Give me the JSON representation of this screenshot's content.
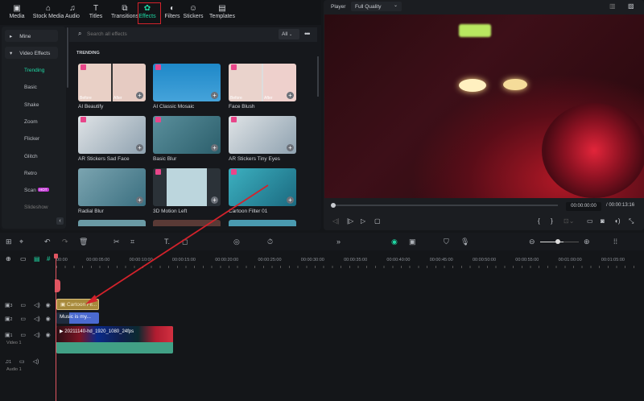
{
  "toolbar": {
    "tabs": [
      {
        "label": "Media",
        "icon": "media-icon"
      },
      {
        "label": "Stock Media",
        "icon": "stock-icon"
      },
      {
        "label": "Audio",
        "icon": "music-icon"
      },
      {
        "label": "Titles",
        "icon": "title-icon"
      },
      {
        "label": "Transitions",
        "icon": "transition-icon"
      },
      {
        "label": "Effects",
        "icon": "effects-icon",
        "active": true
      },
      {
        "label": "Filters",
        "icon": "filter-icon"
      },
      {
        "label": "Stickers",
        "icon": "sticker-icon"
      },
      {
        "label": "Templates",
        "icon": "template-icon"
      }
    ]
  },
  "sidebar": {
    "groups": [
      {
        "label": "Mine"
      },
      {
        "label": "Video Effects"
      }
    ],
    "items": [
      "Trending",
      "Basic",
      "Shake",
      "Zoom",
      "Flicker",
      "Glitch",
      "Retro",
      "Scan",
      "Slideshow"
    ],
    "scan_badge": "HOT"
  },
  "search": {
    "placeholder": "Search all effects",
    "filter": "All"
  },
  "section_title": "TRENDING",
  "effects": [
    {
      "label": "AI Beautify",
      "before": "Before",
      "after": "After"
    },
    {
      "label": "AI Classic Mosaic"
    },
    {
      "label": "Face Blush",
      "before": "Before",
      "after": "After"
    },
    {
      "label": "AR Stickers Sad Face"
    },
    {
      "label": "Basic Blur"
    },
    {
      "label": "AR Stickers Tiny Eyes"
    },
    {
      "label": "Radial Blur"
    },
    {
      "label": "3D Motion Left"
    },
    {
      "label": "Cartoon Filter 01"
    }
  ],
  "player": {
    "label": "Player",
    "quality": "Full Quality",
    "current_time": "00:00:00:00",
    "total_time": "/ 00:00:13:16",
    "progress": 0
  },
  "timeline": {
    "ruler": [
      "00:00",
      "00:00:05:00",
      "00:00:10:00",
      "00:00:15:00",
      "00:00:20:00",
      "00:00:25:00",
      "00:00:30:00",
      "00:00:35:00",
      "00:00:40:00",
      "00:00:45:00",
      "00:00:50:00",
      "00:00:55:00",
      "00:01:00:00",
      "00:01:05:00"
    ],
    "tracks": [
      {
        "num": "3"
      },
      {
        "num": "2"
      },
      {
        "num": "1",
        "name": "Video 1"
      },
      {
        "num": "1",
        "name": "Audio 1"
      }
    ],
    "clips": {
      "effect": "Cartoon Fil...",
      "audio_title": "Music is my...",
      "video": "20211140-hd_1920_1080_24fps"
    },
    "zoom_level": 0.6
  },
  "colors": {
    "accent": "#1fd8a4",
    "highlight": "#e0212a"
  }
}
